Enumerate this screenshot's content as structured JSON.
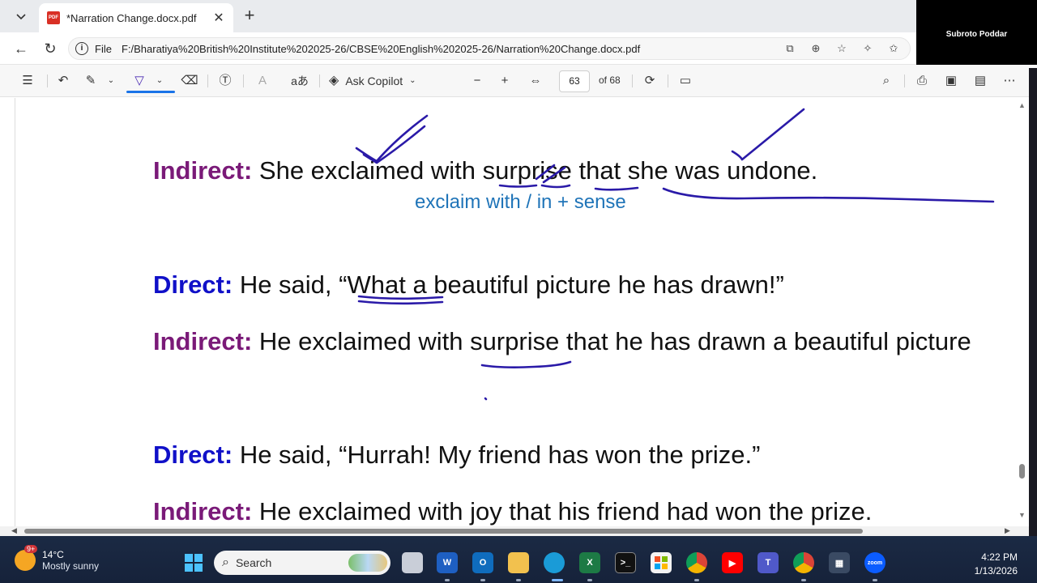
{
  "browser": {
    "tab_title": "*Narration Change.docx.pdf",
    "url_scheme": "File",
    "url": "F:/Bharatiya%20British%20Institute%202025-26/CBSE%20English%202025-26/Narration%20Change.docx.pdf"
  },
  "video": {
    "name": "Subroto Poddar"
  },
  "pdf_toolbar": {
    "ask_copilot": "Ask Copilot",
    "page_current": "63",
    "page_total": "of 68",
    "read_aloud_glyph": "aあ"
  },
  "document": {
    "lines": [
      {
        "label": "Indirect:",
        "kind": "indirect",
        "text": " She exclaimed with surprise that she was undone."
      },
      {
        "label": "Direct:",
        "kind": "direct",
        "text": " He said, “What a beautiful picture he has drawn!”"
      },
      {
        "label": "Indirect:",
        "kind": "indirect",
        "text": " He exclaimed with surprise that he has drawn a beautiful picture"
      },
      {
        "label": "Direct:",
        "kind": "direct",
        "text": " He said, “Hurrah! My friend has won the prize.”"
      },
      {
        "label": "Indirect:",
        "kind": "indirect",
        "text": " He exclaimed with joy that his friend had won the prize."
      }
    ],
    "annotation_note": "exclaim with / in + sense",
    "colors": {
      "indirect_label": "#7a1a78",
      "direct_label": "#1010c8",
      "note": "#1f74b8",
      "ink": "#2a1aa8"
    }
  },
  "taskbar": {
    "weather_badge": "9+",
    "temperature": "14°C",
    "condition": "Mostly sunny",
    "search_placeholder": "Search",
    "time": "4:22 PM",
    "date": "1/13/2026",
    "apps": [
      "windows-start-icon",
      "task-view-icon",
      "word-icon",
      "outlook-icon",
      "file-explorer-icon",
      "edge-icon",
      "excel-icon",
      "terminal-icon",
      "store-icon",
      "chrome-icon",
      "youtube-icon",
      "teams-icon",
      "chrome-profile-icon",
      "calculator-icon",
      "zoom-icon"
    ],
    "app_labels": {
      "word": "W",
      "outlook": "O",
      "excel": "X",
      "zoom": "zoom"
    }
  }
}
